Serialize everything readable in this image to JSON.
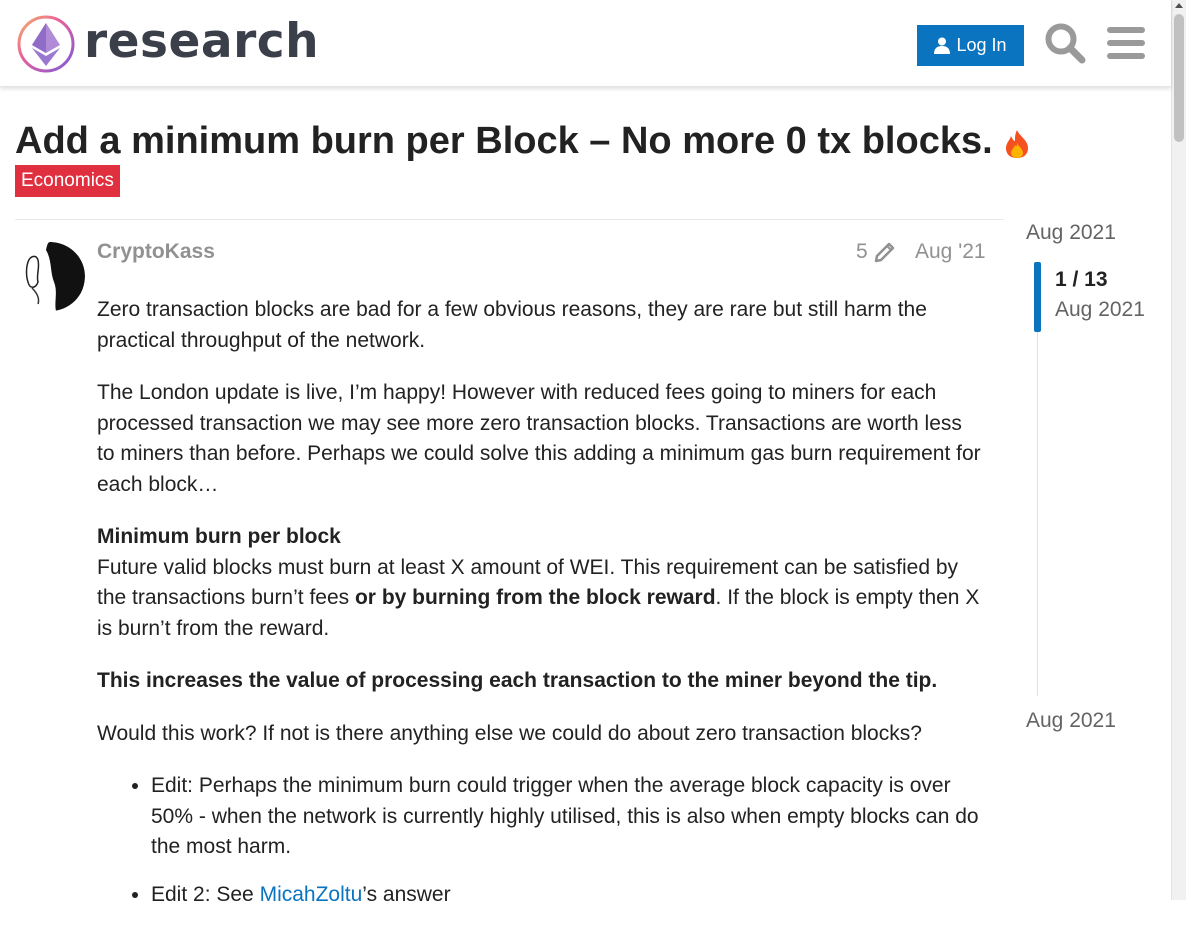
{
  "header": {
    "site_name": "research",
    "login_label": "Log In",
    "brand_color": "#0a74c0"
  },
  "topic": {
    "title": "Add a minimum burn per Block – No more 0 tx blocks.",
    "title_icon": "fire-icon",
    "category": "Economics",
    "category_color": "#e0303f"
  },
  "post": {
    "username": "CryptoKass",
    "edit_count": "5",
    "date": "Aug '21",
    "p1": "Zero transaction blocks are bad for a few obvious reasons, they are rare but still harm the practical throughput of the network.",
    "p2": "The London update is live, I’m happy! However with reduced fees going to miners for each processed transaction we may see more zero transaction blocks. Transactions are worth less to miners than before. Perhaps we could solve this adding a minimum gas burn requirement for each block…",
    "p3_heading": "Minimum burn per block",
    "p3_a": "Future valid blocks must burn at least X amount of WEI. This requirement can be satisfied by the transactions burn’t fees ",
    "p3_bold": "or by burning from the block reward",
    "p3_b": ". If the block is empty then X is burn’t from the reward.",
    "p4": "This increases the value of processing each transaction to the miner beyond the tip.",
    "p5": "Would this work? If not is there anything else we could do about zero transaction blocks?",
    "li1": "Edit: Perhaps the minimum burn could trigger when the average block capacity is over 50% - when the network is currently highly utilised, this is also when empty blocks can do the most harm.",
    "li2_a": "Edit 2: See ",
    "li2_link": "MicahZoltu",
    "li2_b": "’s answer"
  },
  "timeline": {
    "start_date": "Aug 2021",
    "position": "1 / 13",
    "position_date": "Aug 2021",
    "end_date": "Aug 2021"
  }
}
